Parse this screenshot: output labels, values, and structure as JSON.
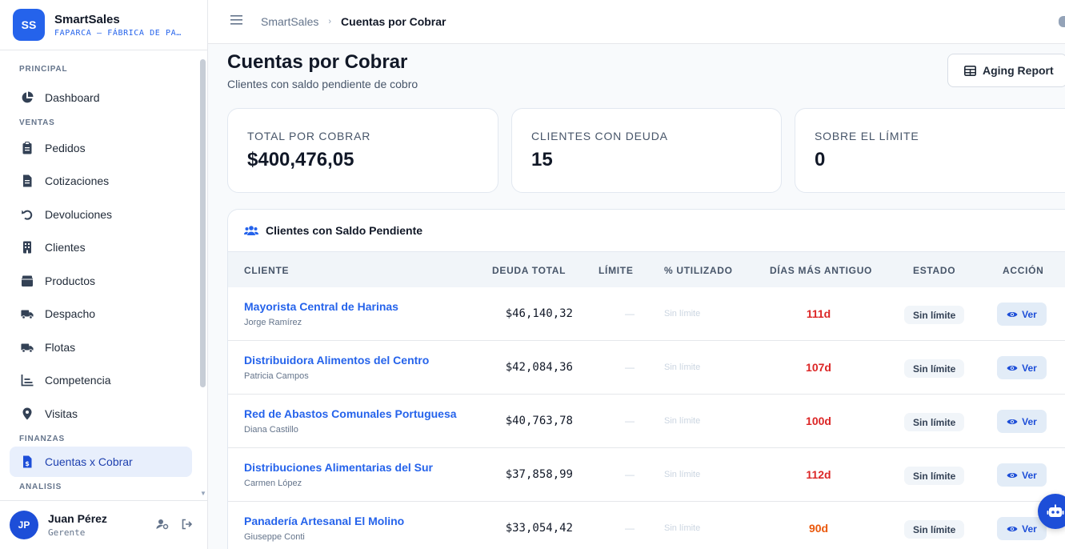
{
  "brand": {
    "logo": "SS",
    "name": "SmartSales",
    "company": "FAPARCA — FÁBRICA DE PA…"
  },
  "sidebar": {
    "sections": [
      {
        "label": "PRINCIPAL",
        "items": [
          {
            "label": "Dashboard",
            "icon": "chart-pie-icon"
          }
        ]
      },
      {
        "label": "VENTAS",
        "items": [
          {
            "label": "Pedidos",
            "icon": "clipboard-icon"
          },
          {
            "label": "Cotizaciones",
            "icon": "document-icon"
          },
          {
            "label": "Devoluciones",
            "icon": "undo-icon"
          },
          {
            "label": "Clientes",
            "icon": "building-icon"
          },
          {
            "label": "Productos",
            "icon": "box-icon"
          },
          {
            "label": "Despacho",
            "icon": "truck-icon"
          },
          {
            "label": "Flotas",
            "icon": "truck-icon"
          },
          {
            "label": "Competencia",
            "icon": "chart-bar-icon"
          },
          {
            "label": "Visitas",
            "icon": "map-pin-icon"
          }
        ]
      },
      {
        "label": "FINANZAS",
        "items": [
          {
            "label": "Cuentas x Cobrar",
            "icon": "invoice-dollar-icon",
            "active": true
          }
        ]
      },
      {
        "label": "ANALISIS",
        "items": []
      }
    ]
  },
  "user": {
    "initials": "JP",
    "name": "Juan Pérez",
    "role": "Gerente"
  },
  "breadcrumb": {
    "home": "SmartSales",
    "current": "Cuentas por Cobrar"
  },
  "page": {
    "title": "Cuentas por Cobrar",
    "subtitle": "Clientes con saldo pendiente de cobro",
    "aging_button": "Aging Report"
  },
  "stats": [
    {
      "label": "TOTAL POR COBRAR",
      "value": "$400,476,05"
    },
    {
      "label": "CLIENTES CON DEUDA",
      "value": "15"
    },
    {
      "label": "SOBRE EL LÍMITE",
      "value": "0"
    }
  ],
  "table": {
    "title": "Clientes con Saldo Pendiente",
    "columns": [
      "CLIENTE",
      "DEUDA TOTAL",
      "LÍMITE",
      "% UTILIZADO",
      "DÍAS MÁS ANTIGUO",
      "ESTADO",
      "ACCIÓN"
    ],
    "rows": [
      {
        "client": "Mayorista Central de Harinas",
        "contact": "Jorge Ramírez",
        "debt": "$46,140,32",
        "limit": "—",
        "used": "Sin límite",
        "days": "111d",
        "status": "Sin límite",
        "action": "Ver"
      },
      {
        "client": "Distribuidora Alimentos del Centro",
        "contact": "Patricia Campos",
        "debt": "$42,084,36",
        "limit": "—",
        "used": "Sin límite",
        "days": "107d",
        "status": "Sin límite",
        "action": "Ver"
      },
      {
        "client": "Red de Abastos Comunales Portuguesa",
        "contact": "Diana Castillo",
        "debt": "$40,763,78",
        "limit": "—",
        "used": "Sin límite",
        "days": "100d",
        "status": "Sin límite",
        "action": "Ver"
      },
      {
        "client": "Distribuciones Alimentarias del Sur",
        "contact": "Carmen López",
        "debt": "$37,858,99",
        "limit": "—",
        "used": "Sin límite",
        "days": "112d",
        "status": "Sin límite",
        "action": "Ver"
      },
      {
        "client": "Panadería Artesanal El Molino",
        "contact": "Giuseppe Conti",
        "debt": "$33,054,42",
        "limit": "—",
        "used": "Sin límite",
        "days": "90d",
        "status": "Sin límite",
        "action": "Ver"
      }
    ]
  },
  "colors": {
    "accent": "#2563eb",
    "days_red": "#dc2626",
    "days_orange": "#ea580c"
  }
}
